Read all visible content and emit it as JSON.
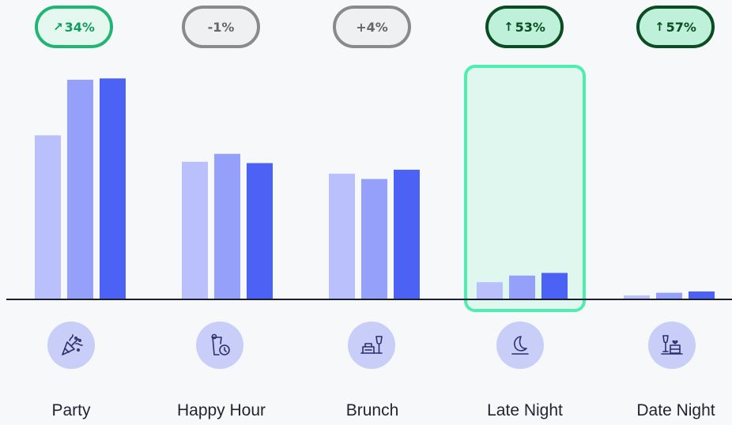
{
  "chart_data": {
    "type": "bar",
    "categories": [
      "Party",
      "Happy Hour",
      "Brunch",
      "Late Night",
      "Date Night"
    ],
    "series": [
      {
        "values": [
          62,
          52,
          47.5,
          6.5,
          1.5
        ],
        "color": "#b9c0fb"
      },
      {
        "values": [
          83,
          55,
          45.5,
          9,
          2.5
        ],
        "color": "#95a0fb"
      },
      {
        "values": [
          83.5,
          51.5,
          49,
          10,
          3
        ],
        "color": "#4b62f4"
      }
    ],
    "highlight_category": "Late Night",
    "changes": [
      {
        "text": "34%",
        "arrow": "↗",
        "style": "up-light"
      },
      {
        "text": "-1%",
        "arrow": "",
        "style": "neutral"
      },
      {
        "text": "+4%",
        "arrow": "",
        "style": "neutral"
      },
      {
        "text": "53%",
        "arrow": "↑",
        "style": "up-dark"
      },
      {
        "text": "57%",
        "arrow": "↑",
        "style": "up-dark"
      }
    ],
    "ylim": [
      0,
      100
    ],
    "grid": false,
    "icons": [
      "party-popper-icon",
      "happy-hour-clock-icon",
      "brunch-icon",
      "moon-icon",
      "date-night-icon"
    ]
  },
  "colors": {
    "baseline": "#1a1f2e",
    "highlight_border": "#4bef b0",
    "highlight_fill": "#dff7ef",
    "icon_bg": "#c9cef9",
    "icon_stroke": "#2c2f6b"
  }
}
